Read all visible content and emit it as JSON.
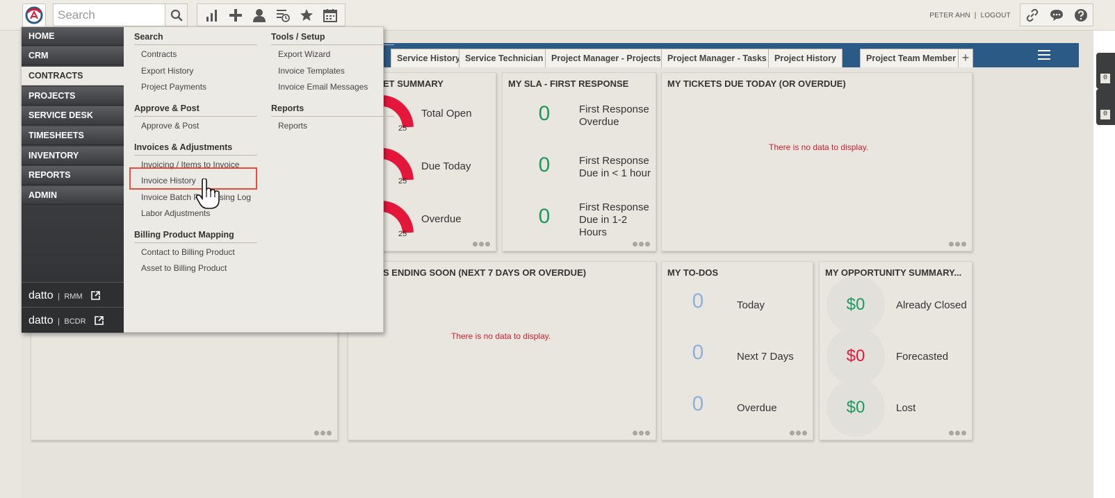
{
  "topbar": {
    "search_placeholder": "Search",
    "tools": [
      "bar-chart-icon",
      "plus-icon",
      "user-icon",
      "list-clock-icon",
      "star-icon",
      "calendar-icon"
    ],
    "user_name": "PETER AHN",
    "separator": "|",
    "logout_label": "LOGOUT",
    "right_icons": [
      "link-icon",
      "chat-icon",
      "help-icon"
    ]
  },
  "side_tabs": [
    "0",
    "0"
  ],
  "tabs": [
    "Service History",
    "Service Technician",
    "Project Manager - Projects",
    "Project Manager - Tasks",
    "Project History",
    "Project Team Member"
  ],
  "tab_add": "+",
  "widgets": {
    "ticket_summary": {
      "title": "ET SUMMARY",
      "rows": [
        {
          "label": "Total Open",
          "scale": "25"
        },
        {
          "label": "Due Today",
          "scale": "25"
        },
        {
          "label": "Overdue",
          "scale": "25"
        }
      ]
    },
    "sla": {
      "title": "MY SLA - FIRST RESPONSE",
      "rows": [
        {
          "value": "0",
          "label_1": "First Response",
          "label_2": "Overdue",
          "label_3": ""
        },
        {
          "value": "0",
          "label_1": "First Response",
          "label_2": "Due in < 1 hour",
          "label_3": ""
        },
        {
          "value": "0",
          "label_1": "First Response",
          "label_2": "Due in 1-2",
          "label_3": "Hours"
        }
      ]
    },
    "tickets_due": {
      "title": "MY TICKETS DUE TODAY (OR OVERDUE)",
      "empty_text": "There is no data to display."
    },
    "ending_soon": {
      "title": "S ENDING SOON (NEXT 7 DAYS OR OVERDUE)",
      "empty_text": "There is no data to display."
    },
    "todos": {
      "title": "MY TO-DOS",
      "rows": [
        {
          "value": "0",
          "label": "Today"
        },
        {
          "value": "0",
          "label": "Next 7 Days"
        },
        {
          "value": "0",
          "label": "Overdue"
        }
      ]
    },
    "opportunity": {
      "title": "MY OPPORTUNITY SUMMARY...",
      "rows": [
        {
          "value": "$0",
          "label": "Already Closed",
          "color": "#1f9a5e"
        },
        {
          "value": "$0",
          "label": "Forecasted",
          "color": "#e01a3c"
        },
        {
          "value": "$0",
          "label": "Lost",
          "color": "#1f9a5e"
        }
      ]
    }
  },
  "nav": {
    "items": [
      "HOME",
      "CRM",
      "CONTRACTS",
      "PROJECTS",
      "SERVICE DESK",
      "TIMESHEETS",
      "INVENTORY",
      "REPORTS",
      "ADMIN"
    ],
    "active": "CONTRACTS",
    "datto_rmm": {
      "brand": "datto",
      "sep": "|",
      "product": "RMM"
    },
    "datto_bcdr": {
      "brand": "datto",
      "sep": "|",
      "product": "BCDR"
    }
  },
  "menu": {
    "col1": [
      {
        "heading": "Search",
        "items": [
          "Contracts",
          "Export History",
          "Project Payments"
        ]
      },
      {
        "heading": "Approve & Post",
        "items": [
          "Approve & Post"
        ]
      },
      {
        "heading": "Invoices & Adjustments",
        "items": [
          "Invoicing / Items to Invoice",
          "Invoice History",
          "Invoice Batch Processing Log",
          "Labor Adjustments"
        ]
      },
      {
        "heading": "Billing Product Mapping",
        "items": [
          "Contact to Billing Product",
          "Asset to Billing Product"
        ]
      }
    ],
    "col2": [
      {
        "heading": "Tools / Setup",
        "items": [
          "Export Wizard",
          "Invoice Templates",
          "Invoice Email Messages"
        ]
      },
      {
        "heading": "Reports",
        "items": [
          "Reports"
        ]
      }
    ],
    "highlighted_item": "Invoice History"
  },
  "colors": {
    "tabbar": "#2c5a86",
    "accent_red": "#e01a3c",
    "accent_green": "#1f9a5e",
    "highlight_border": "#e74c3c"
  }
}
